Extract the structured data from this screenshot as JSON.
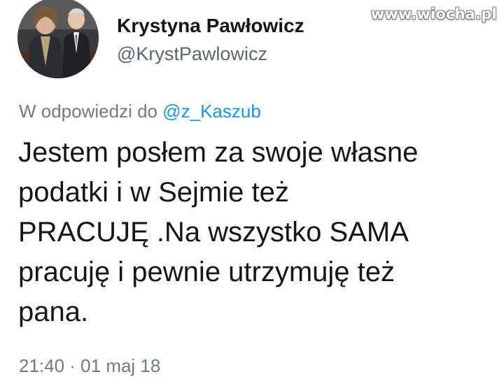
{
  "watermark": "www.wiocha.pl",
  "author": {
    "display_name": "Krystyna Pawłowicz",
    "handle": "@KrystPawlowicz"
  },
  "reply": {
    "prefix": "W odpowiedzi do ",
    "mention": "@z_Kaszub"
  },
  "tweet": {
    "lines": [
      "Jestem posłem za swoje własne",
      "podatki i w Sejmie też",
      "PRACUJĘ .Na wszystko SAMA",
      "pracuję i pewnie utrzymuję też",
      "pana."
    ]
  },
  "timestamp": "21:40 · 01 maj 18",
  "colors": {
    "text": "#14171a",
    "secondary": "#6e7b85",
    "mention": "#1b95e0"
  }
}
